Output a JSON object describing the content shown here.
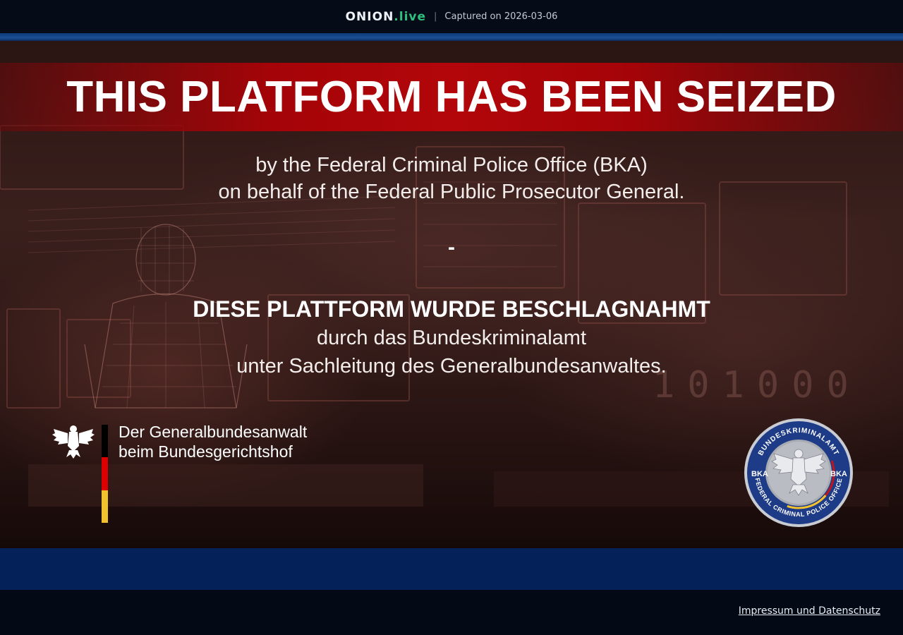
{
  "capture_bar": {
    "brand_main": "ONION",
    "brand_suffix": ".live",
    "separator": "|",
    "captured_text": "Captured on 2026-03-06"
  },
  "hero": {
    "title": "THIS PLATFORM HAS BEEN SEIZED",
    "english_lines": [
      "by the Federal Criminal Police Office (BKA)",
      "on behalf of the Federal Public Prosecutor General."
    ],
    "divider": "-",
    "german_title": "DIESE PLATTFORM WURDE BESCHLAGNAHMT",
    "german_lines": [
      "durch das Bundeskriminalamt",
      "unter Sachleitung des Generalbundesanwaltes."
    ],
    "background_binary": "101000"
  },
  "gba_logo": {
    "line1": "Der Generalbundesanwalt",
    "line2": "beim Bundesgerichtshof",
    "flag_colors": [
      "#000000",
      "#dd0000",
      "#f2c12e"
    ]
  },
  "bka_seal": {
    "top_text": "BUNDESKRIMINALAMT",
    "bottom_text": "FEDERAL CRIMINAL POLICE OFFICE",
    "side_left": "BKA",
    "side_right": "BKA"
  },
  "footer": {
    "link_label": "Impressum und Datenschutz"
  },
  "colors": {
    "red_band": "#b2060a",
    "brand_accent": "#2fbf7f",
    "blue_band": "#05215a"
  }
}
